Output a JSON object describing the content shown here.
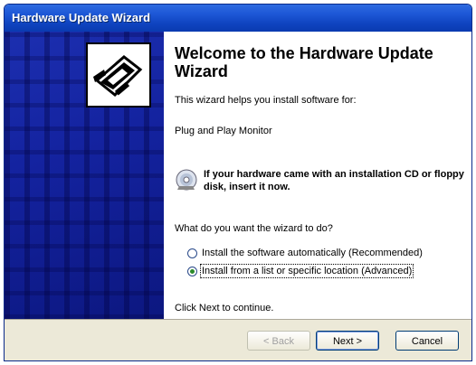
{
  "window": {
    "title": "Hardware Update Wizard"
  },
  "content": {
    "heading": "Welcome to the Hardware Update Wizard",
    "intro": "This wizard helps you install software for:",
    "device": "Plug and Play Monitor",
    "cd_notice": "If your hardware came with an installation CD or floppy disk, insert it now.",
    "question": "What do you want the wizard to do?",
    "options": [
      {
        "label": "Install the software automatically (Recommended)",
        "selected": false
      },
      {
        "label": "Install from a list or specific location (Advanced)",
        "selected": true
      }
    ],
    "continue_hint": "Click Next to continue."
  },
  "buttons": {
    "back": "< Back",
    "next": "Next >",
    "cancel": "Cancel"
  },
  "colors": {
    "titlebar": "#0f44c0",
    "sidebar": "#1423a0",
    "footer": "#ece9d8"
  },
  "icons": {
    "wizard_logo": "hardware-card-icon",
    "cd": "cd-disk-icon"
  }
}
